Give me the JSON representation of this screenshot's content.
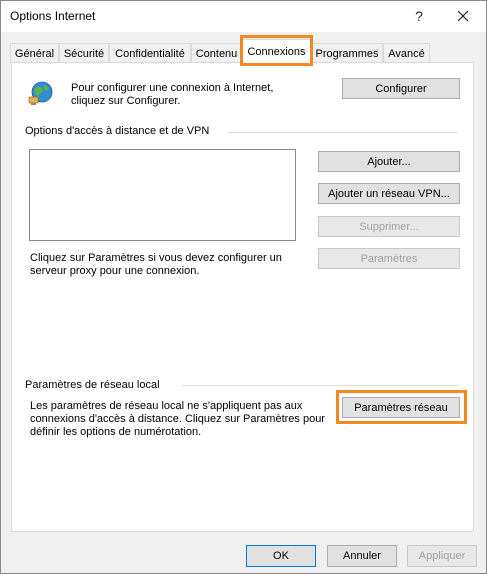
{
  "window": {
    "title": "Options Internet",
    "help_glyph": "?",
    "close_glyph": "✕"
  },
  "tabs": [
    {
      "label": "Général",
      "active": false
    },
    {
      "label": "Sécurité",
      "active": false
    },
    {
      "label": "Confidentialité",
      "active": false
    },
    {
      "label": "Contenu",
      "active": false
    },
    {
      "label": "Connexions",
      "active": true
    },
    {
      "label": "Programmes",
      "active": false
    },
    {
      "label": "Avancé",
      "active": false
    }
  ],
  "setup": {
    "icon": "globe-network-icon",
    "text": "Pour configurer une connexion à Internet, cliquez sur Configurer.",
    "button": "Configurer"
  },
  "dialup": {
    "section_label": "Options d'accès à distance et de VPN",
    "buttons": {
      "add": "Ajouter...",
      "add_vpn": "Ajouter un réseau VPN...",
      "remove": "Supprimer...",
      "settings": "Paramètres"
    },
    "proxy_text": "Cliquez sur Paramètres si vous devez configurer un serveur proxy pour une connexion."
  },
  "lan": {
    "section_label": "Paramètres de réseau local",
    "text": "Les paramètres de réseau local ne s'appliquent pas aux connexions d'accès à distance. Cliquez sur Paramètres pour définir les options de numérotation.",
    "button": "Paramètres réseau"
  },
  "footer": {
    "ok": "OK",
    "cancel": "Annuler",
    "apply": "Appliquer"
  },
  "colors": {
    "highlight": "#f28a1f",
    "default_button_border": "#0078d7"
  }
}
